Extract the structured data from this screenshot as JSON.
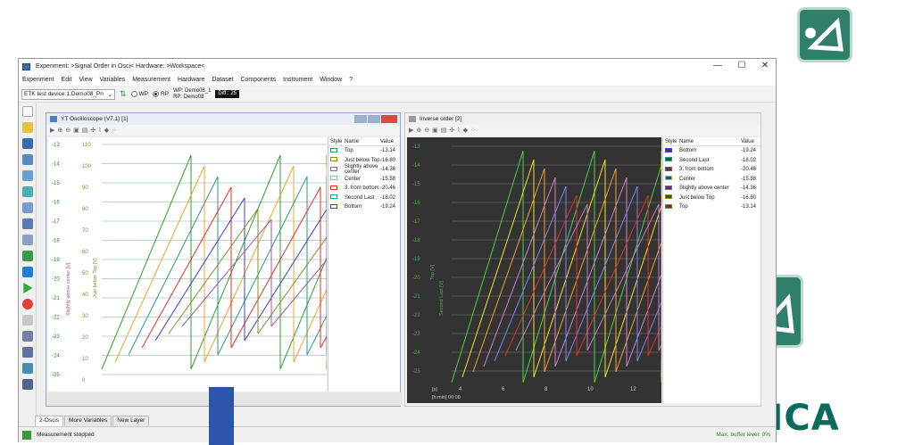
{
  "window": {
    "title": "Experiment: >Signal Order in Osci< Hardware: >Workspace<",
    "controls": {
      "minimize": "—",
      "maximize": "☐",
      "close": "✕"
    }
  },
  "menu": [
    "Experiment",
    "Edit",
    "View",
    "Variables",
    "Measurement",
    "Hardware",
    "Dataset",
    "Components",
    "Instrument",
    "Window",
    "?"
  ],
  "toolbar": {
    "device_select": "ETK test device:1:Demo08_Pn",
    "wp_label": "WP",
    "rp_label": "RP",
    "wp_text": "WP: Demo08_1",
    "rp_text": "RP: Demo08",
    "diff": "Diff.: 25"
  },
  "osci1": {
    "title": "YT Oscilloscope (V7.1) [1]",
    "legend_headers": {
      "style": "Style",
      "name": "Name",
      "value": "Value"
    },
    "rows": [
      {
        "name": "Top",
        "value": "-13.14",
        "color": "#2ca02c"
      },
      {
        "name": "Just below Top",
        "value": "-16.80",
        "color": "#8b8b2a"
      },
      {
        "name": "Slightly above center",
        "value": "-14.36",
        "color": "#a05aa0"
      },
      {
        "name": "Center",
        "value": "-15.58",
        "color": "#f0a030"
      },
      {
        "name": "3. from bottom",
        "value": "-20.46",
        "color": "#e0302a"
      },
      {
        "name": "Second Last",
        "value": "-18.02",
        "color": "#2a9a8a"
      },
      {
        "name": "Bottom",
        "value": "-19.24",
        "color": "#4040c0"
      }
    ],
    "yticks_left": [
      "-13",
      "-14",
      "-15",
      "-16",
      "-17",
      "-18",
      "-19",
      "-20",
      "-21",
      "-22",
      "-23",
      "-24",
      "-25"
    ],
    "yticks_mid": [
      "110",
      "100",
      "90",
      "80",
      "70",
      "60",
      "50",
      "40",
      "30",
      "20",
      "10",
      "0"
    ],
    "axis_label_1": "Slightly above center [V]",
    "axis_label_2": "Just below Top [V]"
  },
  "osci2": {
    "title": "Inverse order [2]",
    "legend_headers": {
      "style": "Style",
      "name": "Name",
      "value": "Value"
    },
    "rows": [
      {
        "name": "Bottom",
        "value": "-19.24"
      },
      {
        "name": "Second Last",
        "value": "-18.02"
      },
      {
        "name": "3. from bottom",
        "value": "-20.46"
      },
      {
        "name": "Center",
        "value": "-15.58"
      },
      {
        "name": "Slightly above center",
        "value": "-14.36"
      },
      {
        "name": "Just below Top",
        "value": "-16.80"
      },
      {
        "name": "Top",
        "value": "-13.14"
      }
    ],
    "yticks": [
      "-13",
      "-14",
      "-15",
      "-16",
      "-17",
      "-18",
      "-19",
      "-20",
      "-21",
      "-22",
      "-23",
      "-24",
      "-25"
    ],
    "xticks": [
      "4",
      "6",
      "8",
      "10",
      "12"
    ],
    "xunit": "[s]",
    "time_label": "[h:min] 00:00",
    "axis_label_1": "Top [V]",
    "axis_label_2": "Second Last [V]"
  },
  "tabs": [
    "2-Oscis",
    "More Variables",
    "New Layer"
  ],
  "status": {
    "left": "Measurement stopped",
    "right": "Max. buffer level: 0%"
  },
  "brand": {
    "name": "INCA",
    "color": "#0b6a5c"
  }
}
